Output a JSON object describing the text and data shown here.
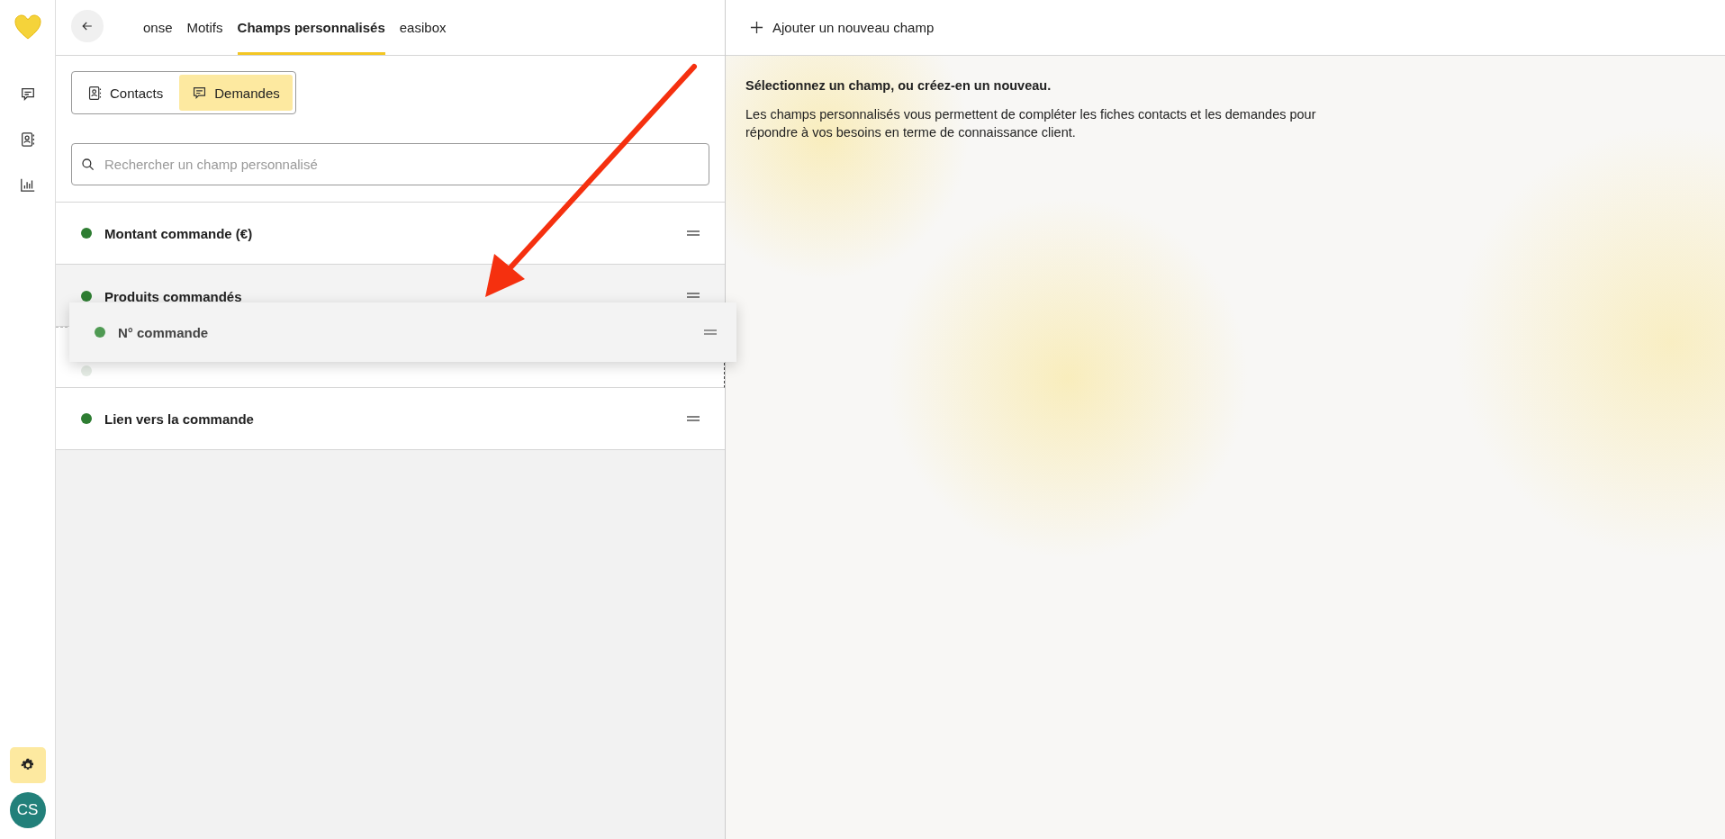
{
  "sidebar": {
    "items": [
      {
        "selected": false
      },
      {
        "selected": false
      },
      {
        "selected": false
      }
    ],
    "settings": {
      "selected": true
    },
    "avatar": "CS"
  },
  "nav_tabs": [
    {
      "label": "onse",
      "selected": false
    },
    {
      "label": "Motifs",
      "selected": false
    },
    {
      "label": "Champs personnalisés",
      "selected": true
    },
    {
      "label": "easibox",
      "selected": false
    }
  ],
  "segments": [
    {
      "label": "Contacts",
      "selected": false
    },
    {
      "label": "Demandes",
      "selected": true
    }
  ],
  "search": {
    "placeholder": "Rechercher un champ personnalisé"
  },
  "fields": [
    {
      "kind": "field",
      "label": "Montant commande (€)",
      "color": "#2e7d32",
      "hovered": false
    },
    {
      "kind": "field",
      "label": "Produits commandés",
      "color": "#2e7d32",
      "hovered": true
    },
    {
      "kind": "drop_placeholder",
      "color": "#e4ebe4"
    },
    {
      "kind": "field",
      "label": "Lien vers la commande",
      "color": "#2e7d32",
      "hovered": false
    }
  ],
  "dragged_field": {
    "label": "N° commande",
    "color": "#4f9a53"
  },
  "add_button": "Ajouter un nouveau champ",
  "empty_state": {
    "title": "Sélectionnez un champ, ou créez-en un nouveau.",
    "text": "Les champs personnalisés vous permettent de compléter les fiches contacts et les demandes pour répondre à vos besoins en terme de connaissance client."
  }
}
